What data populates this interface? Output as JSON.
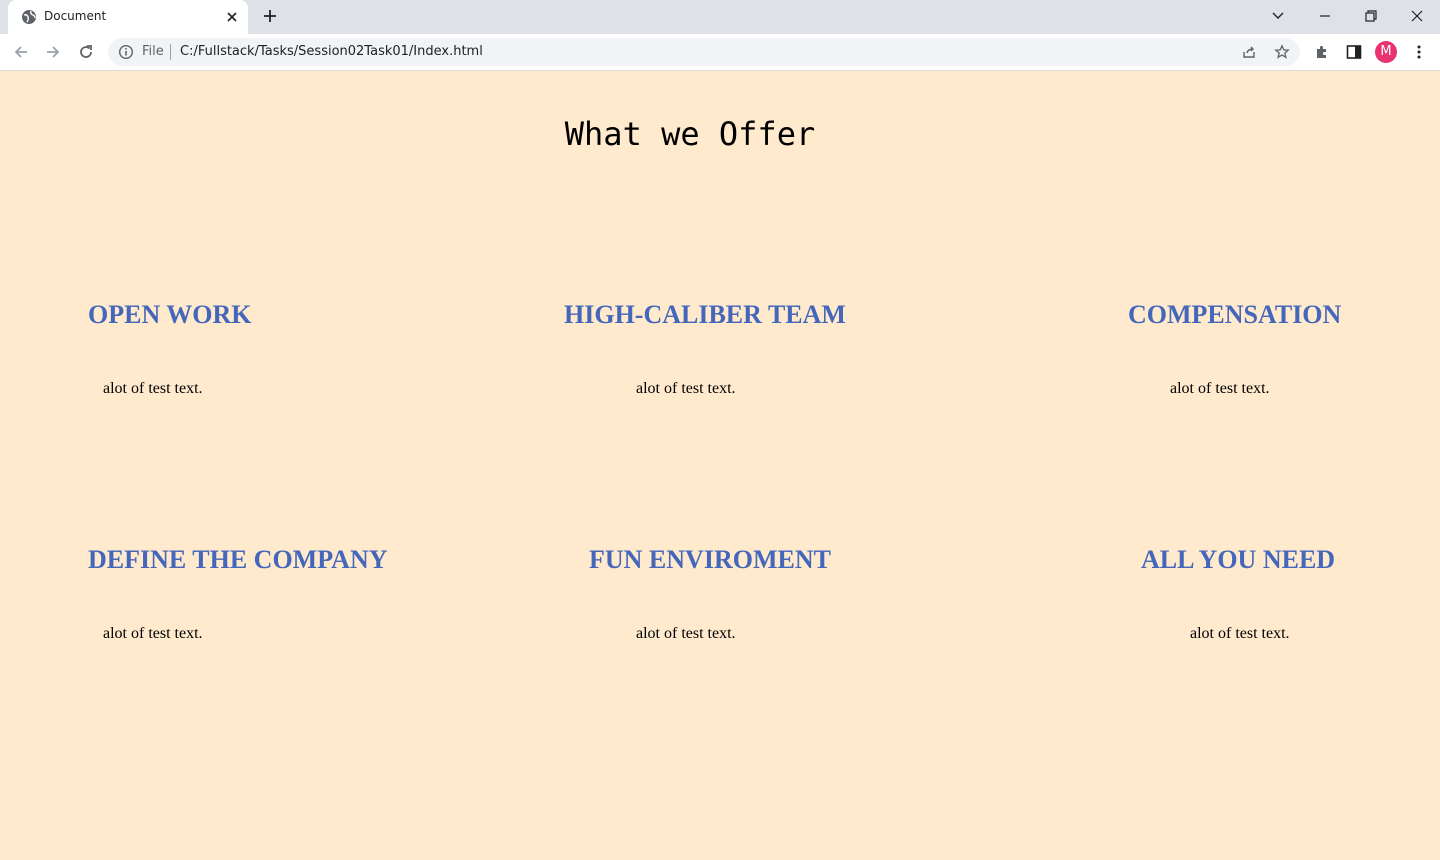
{
  "browser": {
    "tab_title": "Document",
    "address_scheme": "File",
    "address_url": "C:/Fullstack/Tasks/Session02Task01/Index.html",
    "profile_initial": "M",
    "colors": {
      "tabbar": "#dee1e6",
      "avatar": "#e8336f"
    }
  },
  "page": {
    "title": "What we Offer",
    "background": "#ffeacd",
    "heading_color": "#4466bb",
    "features": [
      {
        "heading": "OPEN WORK",
        "text": "alot of test text."
      },
      {
        "heading": "HIGH-CALIBER TEAM",
        "text": "alot of test text."
      },
      {
        "heading": "COMPENSATION",
        "text": "alot of test text."
      },
      {
        "heading": "DEFINE THE COMPANY",
        "text": "alot of test text."
      },
      {
        "heading": "FUN ENVIROMENT",
        "text": "alot of test text."
      },
      {
        "heading": "ALL YOU NEED",
        "text": "alot of test text."
      }
    ]
  }
}
